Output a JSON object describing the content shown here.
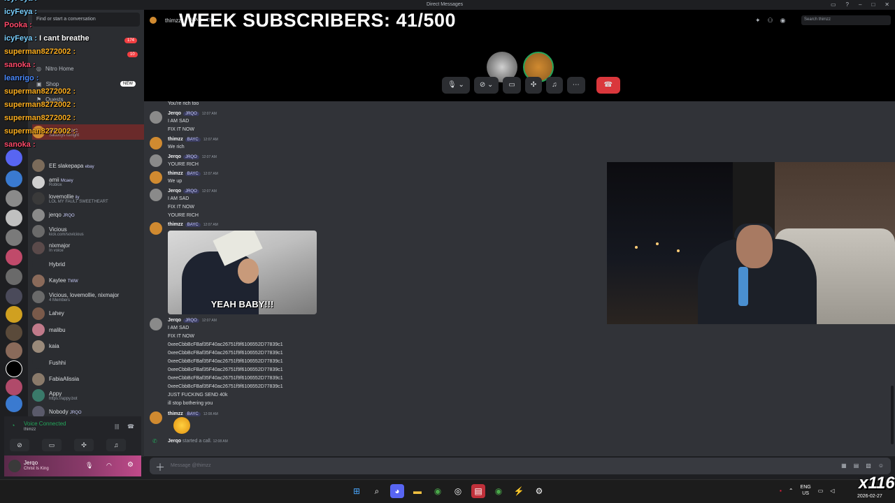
{
  "titlebar": {
    "title": "Direct Messages"
  },
  "stream": {
    "week_subscribers": "WEEK SUBSCRIBERS: 41/500",
    "watermark": "x116"
  },
  "chat_overlay": [
    {
      "user": "icyFeya :",
      "color": "#7ad0ff"
    },
    {
      "user": "icyFeya :",
      "color": "#7ad0ff"
    },
    {
      "user": "Pooka :",
      "color": "#ff4a6a"
    },
    {
      "user": "icyFeya :",
      "color": "#7ad0ff",
      "text": "I cant breathe"
    },
    {
      "user": "superman8272002 :",
      "color": "#ffb020"
    },
    {
      "user": "sanoka :",
      "color": "#ff4a6a"
    },
    {
      "user": "leanrigo :",
      "color": "#4a8aff"
    },
    {
      "user": "superman8272002 :",
      "color": "#ffb020"
    },
    {
      "user": "superman8272002 :",
      "color": "#ffb020"
    },
    {
      "user": "superman8272002 :",
      "color": "#ffb020"
    },
    {
      "user": "superman8272002 :",
      "color": "#ffb020"
    },
    {
      "user": "sanoka :",
      "color": "#ff4a6a"
    }
  ],
  "sidebar": {
    "find_placeholder": "Find or start a conversation",
    "nav": [
      {
        "label": "Nitro Home"
      },
      {
        "label": "Shop",
        "badge": "NEW"
      },
      {
        "label": "Quests"
      }
    ],
    "badges": {
      "b1": "174",
      "b2": "10"
    },
    "dm_first": {
      "name": "thimzz",
      "tag": "BAYC",
      "status": "Sadboys tonight"
    },
    "dms": [
      {
        "name": "EE slakepapa",
        "tag": "ebay",
        "sub": "",
        "color": "#7b6b5a"
      },
      {
        "name": "amii",
        "tag": "Mcaey",
        "sub": "Roblox",
        "color": "#d0d0d0"
      },
      {
        "name": "lovemollie",
        "tag": "ily",
        "sub": "LOL MY FAULT SWEETHEART",
        "color": "#3a3a3a"
      },
      {
        "name": "jerqo",
        "tag": "JRQO",
        "sub": "",
        "color": "#8a8a8a"
      },
      {
        "name": "Vicious",
        "tag": "",
        "sub": "kick.com/sovicious",
        "color": "#6a6a6a"
      },
      {
        "name": "nixmajor",
        "tag": "",
        "sub": "In voice",
        "color": "#5a4a4a"
      },
      {
        "name": "Hybrid",
        "tag": "",
        "sub": "",
        "color": "#2b2d31"
      },
      {
        "name": "Kaylee",
        "tag": "TWW",
        "sub": "",
        "color": "#8a6a5a"
      },
      {
        "name": "Vicious, lovemollie, nixmajor",
        "tag": "",
        "sub": "4 Members",
        "color": "#6a6a6a"
      },
      {
        "name": "Lahey",
        "tag": "",
        "sub": "",
        "color": "#7a5a4a"
      },
      {
        "name": "malibu",
        "tag": "",
        "sub": "",
        "color": "#c07a8a"
      },
      {
        "name": "kaia",
        "tag": "",
        "sub": "",
        "color": "#9a8a7a"
      },
      {
        "name": "Fushhi",
        "tag": "",
        "sub": "",
        "color": "#2b2d31"
      },
      {
        "name": "FabiaAlissia",
        "tag": "",
        "sub": "",
        "color": "#8a7a6a"
      },
      {
        "name": "Appy",
        "tag": "",
        "sub": "https://appy.bot",
        "color": "#3a7a6a"
      },
      {
        "name": "Nobody",
        "tag": "JRQO",
        "sub": "",
        "color": "#5a5a6a"
      }
    ],
    "voice": {
      "status": "Voice Connected",
      "channel": "thimzz"
    },
    "user": {
      "name": "Jerqo",
      "status": "Christ Is King"
    }
  },
  "call": {
    "header_name": "thimzz",
    "aka": "AKA",
    "aka_name": "Thimz",
    "search_placeholder": "Search thimzz"
  },
  "messages": {
    "top_line": "You're rich too",
    "groups": [
      {
        "user": "Jerqo",
        "tag": "JRQO",
        "time": "12:07 AM",
        "lines": [
          "I AM SAD",
          "FIX IT NOW"
        ]
      },
      {
        "user": "thimzz",
        "tag": "BAYC",
        "time": "12:07 AM",
        "lines": [
          "We rich"
        ]
      },
      {
        "user": "Jerqo",
        "tag": "JRQO",
        "time": "12:07 AM",
        "lines": [
          "YOURE RICH"
        ]
      },
      {
        "user": "thimzz",
        "tag": "BAYC",
        "time": "12:07 AM",
        "lines": [
          "We up"
        ]
      },
      {
        "user": "Jerqo",
        "tag": "JRQO",
        "time": "12:07 AM",
        "lines": [
          "I AM SAD",
          "FIX IT NOW",
          "YOURE RICH"
        ]
      },
      {
        "user": "thimzz",
        "tag": "BAYC",
        "time": "12:07 AM",
        "lines": []
      },
      {
        "user": "Jerqo",
        "tag": "JRQO",
        "time": "12:07 AM",
        "lines": [
          "I AM SAD",
          "FIX IT NOW",
          "0xeeCbbBcFBaf35F40ac26751f9f6106552D77839c1",
          "0xeeCbbBcFBaf35F40ac26751f9f6106552D77839c1",
          "0xeeCbbBcFBaf35F40ac26751f9f6106552D77839c1",
          "0xeeCbbBcFBaf35F40ac26751f9f6106552D77839c1",
          "0xeeCbbBcFBaf35F40ac26751f9f6106552D77839c1",
          "0xeeCbbBcFBaf35F40ac26751f9f6106552D77839c1",
          "JUST FUCKING SEND 40k",
          "ill stop bothering you"
        ]
      },
      {
        "user": "thimzz",
        "tag": "BAYC",
        "time": "12:08 AM",
        "lines": []
      }
    ],
    "gif_caption": "YEAH BABY!!!",
    "call_event_user": "Jerqo",
    "call_event_text": "started a call.",
    "call_event_time": "12:08 AM",
    "input_placeholder": "Message @thimzz"
  },
  "taskbar": {
    "lang_top": "ENG",
    "lang_bottom": "US",
    "date": "2026-02-27"
  }
}
